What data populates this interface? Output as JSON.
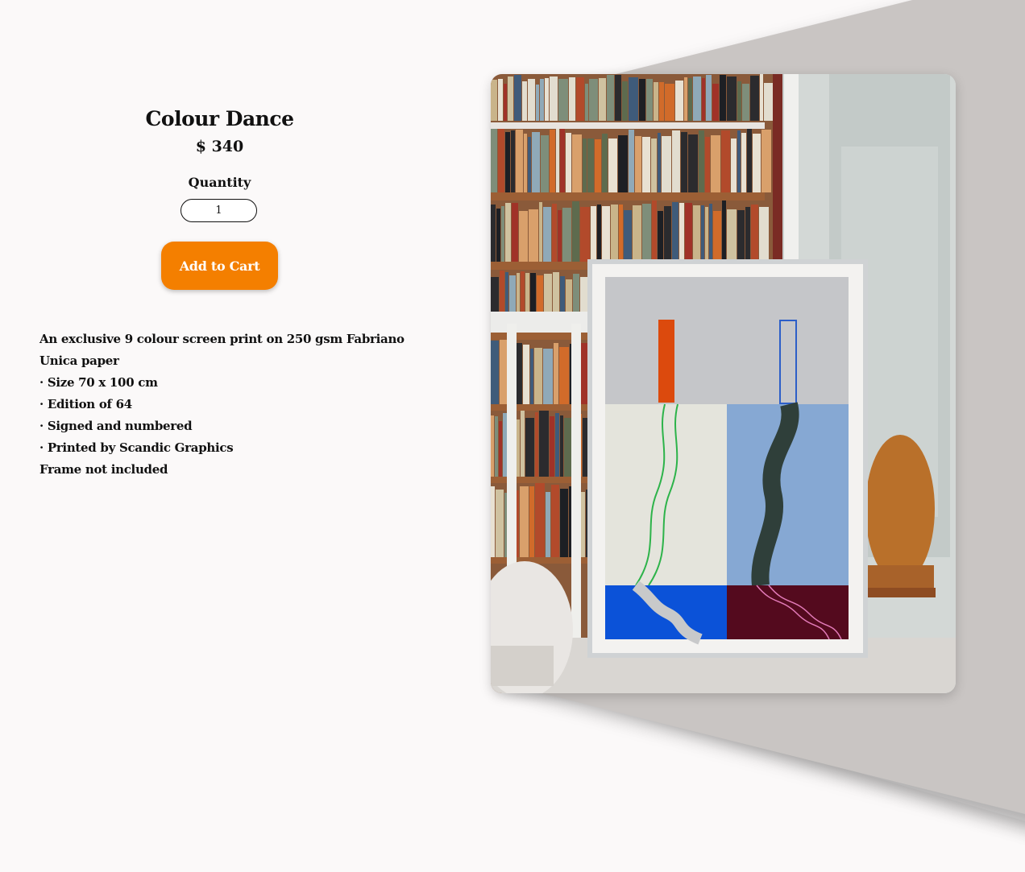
{
  "product": {
    "title": "Colour Dance",
    "price": "$ 340",
    "quantity_label": "Quantity",
    "quantity_value": "1",
    "add_to_cart_label": "Add to Cart",
    "description": [
      "An exclusive 9 colour screen print on 250 gsm Fabriano Unica paper",
      "· Size 70 x 100 cm",
      "· Edition of 64",
      "· Signed and numbered",
      "· Printed by Scandic Graphics",
      "Frame not included"
    ]
  },
  "colors": {
    "background": "#fbf9f9",
    "button": "#f47f00",
    "button_text": "#ffffff"
  }
}
